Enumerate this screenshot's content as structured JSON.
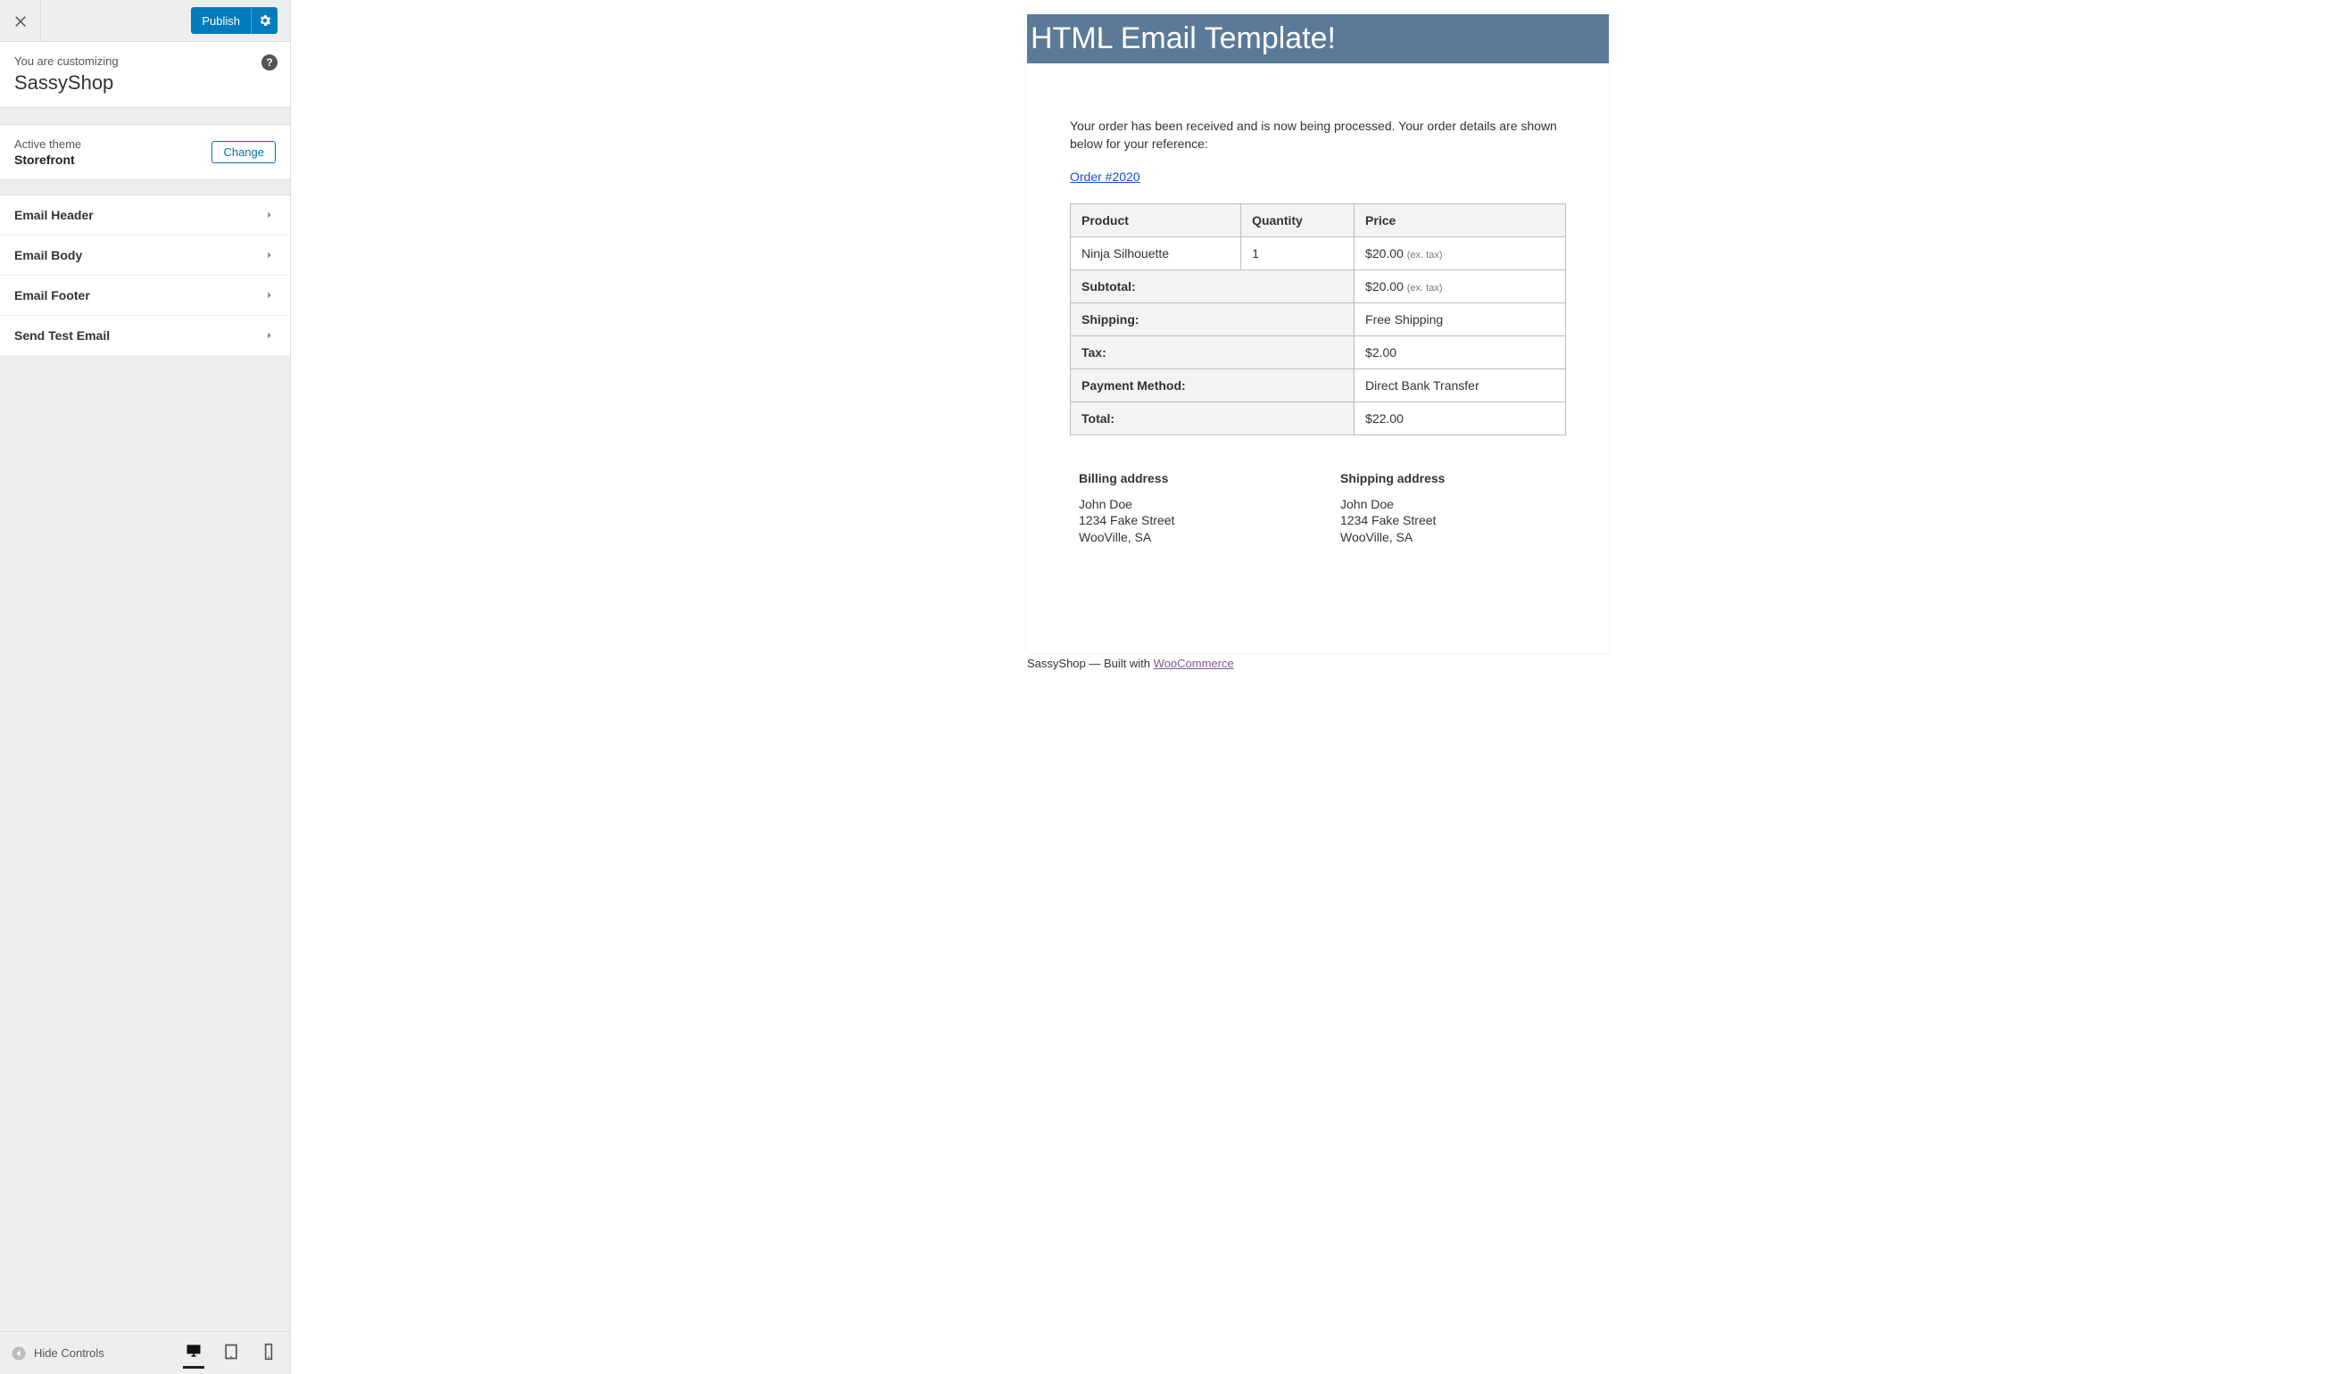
{
  "header": {
    "publish_label": "Publish"
  },
  "customizing": {
    "label": "You are customizing",
    "site_title": "SassyShop"
  },
  "theme_panel": {
    "active_label": "Active theme",
    "theme_name": "Storefront",
    "change_label": "Change"
  },
  "accordion": {
    "items": [
      {
        "label": "Email Header"
      },
      {
        "label": "Email Body"
      },
      {
        "label": "Email Footer"
      },
      {
        "label": "Send Test Email"
      }
    ]
  },
  "footer": {
    "hide_controls_label": "Hide Controls"
  },
  "email": {
    "banner": "HTML Email Template!",
    "intro": "Your order has been received and is now being processed. Your order details are shown below for your reference:",
    "order_link": "Order #2020",
    "table": {
      "headers": {
        "product": "Product",
        "quantity": "Quantity",
        "price": "Price"
      },
      "item": {
        "product": "Ninja Silhouette",
        "quantity": "1",
        "price": "$20.00",
        "tax_note": "(ex. tax)"
      },
      "subtotal": {
        "label": "Subtotal:",
        "value": "$20.00",
        "tax_note": "(ex. tax)"
      },
      "shipping": {
        "label": "Shipping:",
        "value": "Free Shipping"
      },
      "tax": {
        "label": "Tax:",
        "value": "$2.00"
      },
      "payment": {
        "label": "Payment Method:",
        "value": "Direct Bank Transfer"
      },
      "total": {
        "label": "Total:",
        "value": "$22.00"
      }
    },
    "billing": {
      "title": "Billing address",
      "name": "John Doe",
      "street": "1234 Fake Street",
      "city": "WooVille, SA"
    },
    "shipping": {
      "title": "Shipping address",
      "name": "John Doe",
      "street": "1234 Fake Street",
      "city": "WooVille, SA"
    }
  },
  "built_with": {
    "prefix": "SassyShop — Built with ",
    "link": "WooCommerce"
  }
}
